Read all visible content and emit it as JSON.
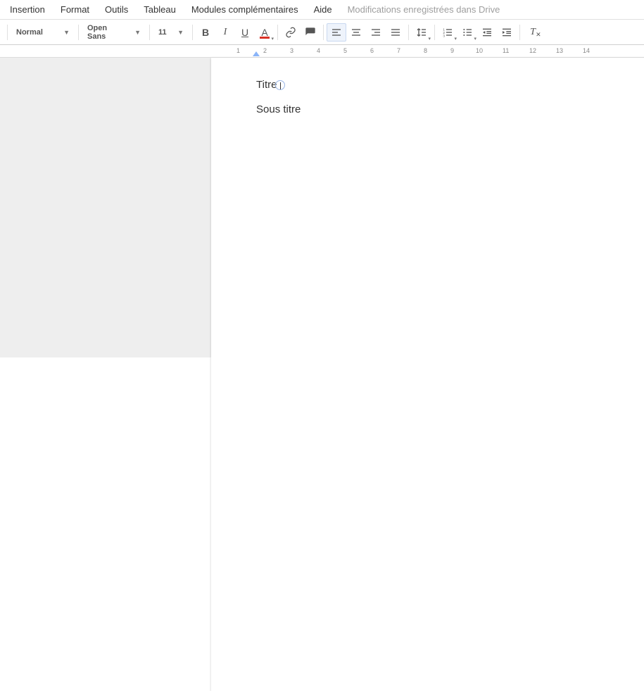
{
  "menu": {
    "insertion": "Insertion",
    "format": "Format",
    "outils": "Outils",
    "tableau": "Tableau",
    "modules": "Modules complémentaires",
    "aide": "Aide",
    "status": "Modifications enregistrées dans Drive"
  },
  "toolbar": {
    "style": "Normal",
    "font": "Open Sans",
    "size": "11"
  },
  "ruler": {
    "n1": "1",
    "n2": "2",
    "n3": "3",
    "n4": "4",
    "n5": "5",
    "n6": "6",
    "n7": "7",
    "n8": "8",
    "n9": "9",
    "n10": "10",
    "n11": "11",
    "n12": "12",
    "n13": "13",
    "n14": "14"
  },
  "document": {
    "title": "Titre",
    "subtitle": "Sous titre"
  }
}
